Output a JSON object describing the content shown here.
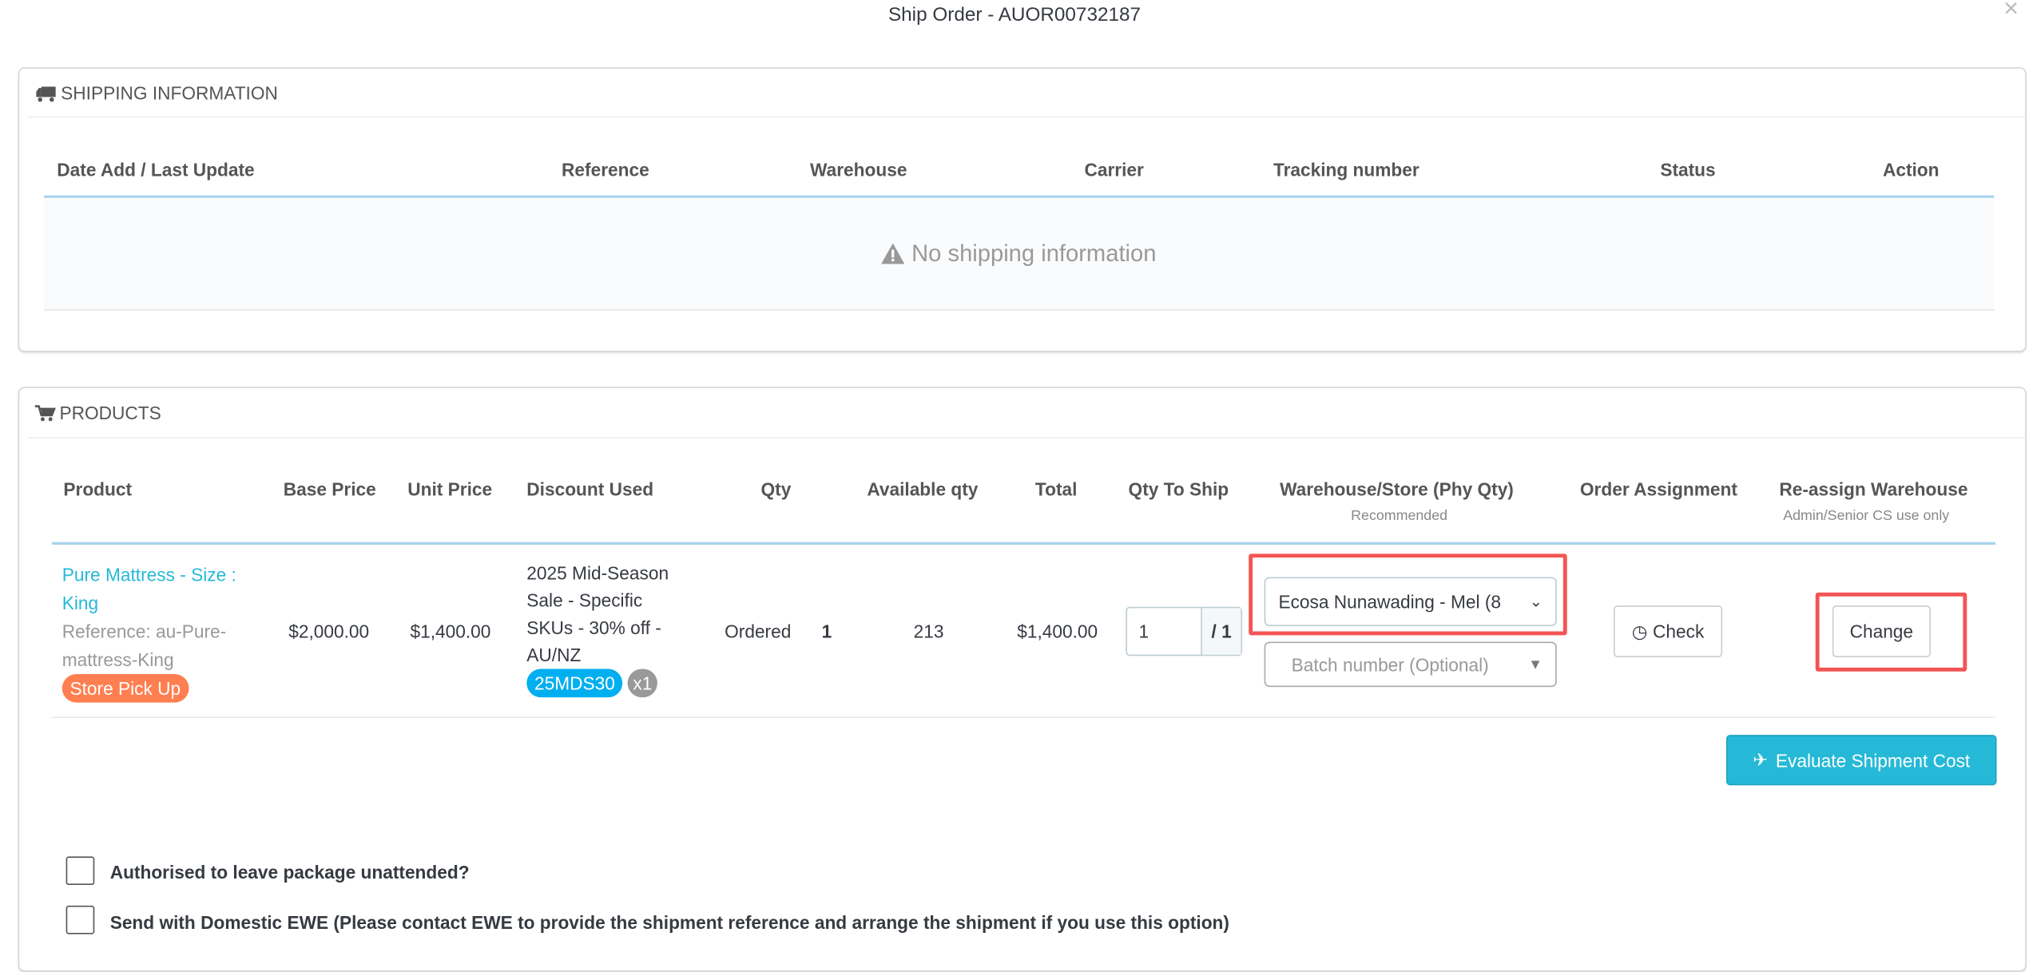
{
  "dialog": {
    "title": "Ship Order - AUOR00732187",
    "close_icon": "×"
  },
  "shipping": {
    "heading": "SHIPPING INFORMATION",
    "columns": [
      "Date Add / Last Update",
      "Reference",
      "Warehouse",
      "Carrier",
      "Tracking number",
      "Status",
      "Action"
    ],
    "empty_text": "No shipping information"
  },
  "products": {
    "heading": "PRODUCTS",
    "columns": [
      "Product",
      "Base Price",
      "Unit Price",
      "Discount Used",
      "Qty",
      "Available qty",
      "Total",
      "Qty To Ship",
      "Warehouse/Store (Phy Qty)",
      "Order Assignment",
      "Re-assign Warehouse"
    ],
    "subheaders": {
      "warehouse": "Recommended",
      "reassign": "Admin/Senior CS use only"
    },
    "row": {
      "name_line1": "Pure Mattress - Size :",
      "name_line2": "King",
      "ref_line1": "Reference: au-Pure-",
      "ref_line2": "mattress-King",
      "delivery_badge": "Store Pick Up",
      "base_price": "$2,000.00",
      "unit_price": "$1,400.00",
      "discount_lines": [
        "2025 Mid-Season",
        "Sale - Specific",
        "SKUs - 30% off -",
        "AU/NZ"
      ],
      "discount_code": "25MDS30",
      "discount_count": "x1",
      "qty_label": "Ordered",
      "qty": "1",
      "available": "213",
      "total": "$1,400.00",
      "qty_to_ship": "1",
      "qty_of": "/ 1",
      "warehouse_selected": "Ecosa Nunawading - Mel (8",
      "batch_placeholder": "Batch number (Optional)",
      "check_label": "Check",
      "change_label": "Change"
    },
    "evaluate_label": "Evaluate Shipment Cost"
  },
  "options": [
    {
      "label": "Authorised to leave package unattended?",
      "checked": false
    },
    {
      "label": "Send with Domestic EWE (Please contact EWE to provide the shipment reference and arrange the shipment if you use this option)",
      "checked": false
    }
  ],
  "colors": {
    "accent": "#25b9d7",
    "badge_orange": "#ff7f50",
    "highlight": "#f45454"
  }
}
